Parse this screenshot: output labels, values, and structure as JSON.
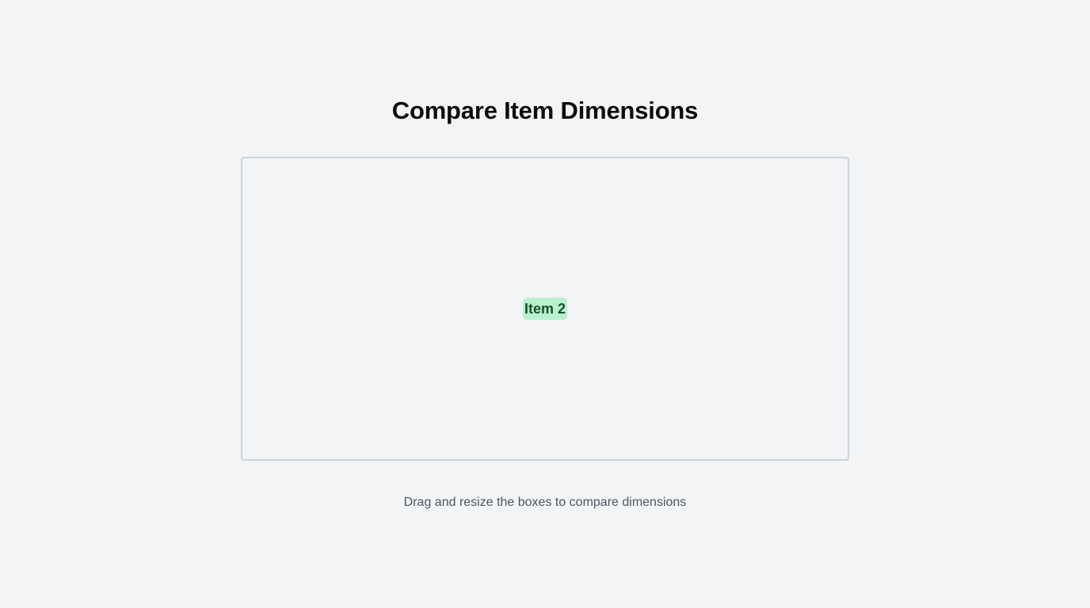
{
  "page": {
    "title": "Compare Item Dimensions",
    "hint": "Drag and resize the boxes to compare dimensions"
  },
  "canvas": {
    "items": [
      {
        "label": "Item 2",
        "color": "#bbf0cf",
        "text_color": "#14532d"
      }
    ]
  },
  "colors": {
    "background": "#f2f4f6",
    "canvas_border": "#cfd3da",
    "title": "#0b0c0e",
    "hint": "#4b5563"
  }
}
